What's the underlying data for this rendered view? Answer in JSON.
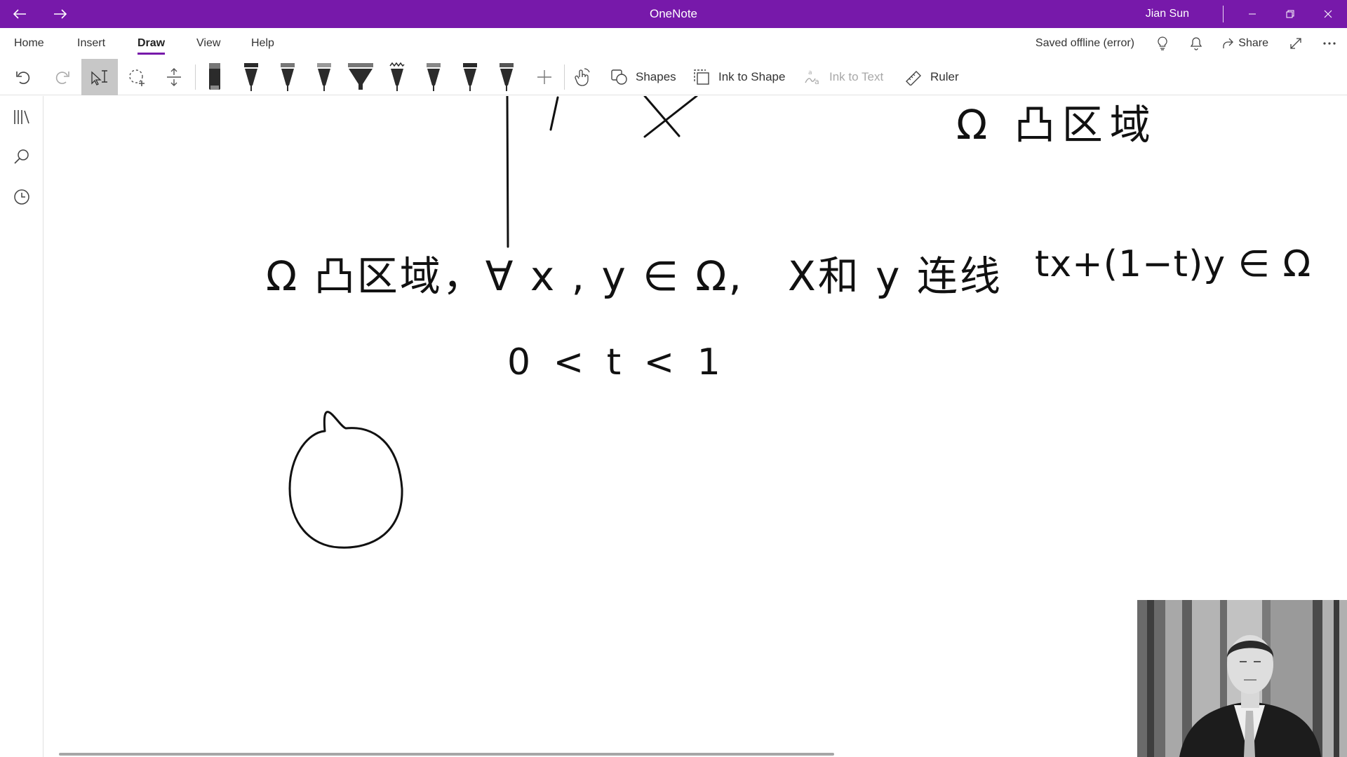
{
  "titlebar": {
    "app_title": "OneNote",
    "user_name": "Jian Sun",
    "back_icon": "arrow-left-icon",
    "forward_icon": "arrow-right-icon"
  },
  "menu": {
    "tabs": [
      {
        "label": "Home"
      },
      {
        "label": "Insert"
      },
      {
        "label": "Draw"
      },
      {
        "label": "View"
      },
      {
        "label": "Help"
      }
    ],
    "active_tab": "Draw",
    "status": "Saved offline (error)",
    "share_label": "Share"
  },
  "ribbon": {
    "shapes_label": "Shapes",
    "ink_to_shape_label": "Ink to Shape",
    "ink_to_text_label": "Ink to Text",
    "ruler_label": "Ruler"
  },
  "canvas": {
    "line1": "Ω 凸区域",
    "line2a": "Ω 凸区域，∀ x , y ∈ Ω,",
    "line2b": "X和 y 连线",
    "line2c": "tx+(1−t)y ∈ Ω",
    "line3": "0 < t < 1"
  },
  "colors": {
    "accent": "#7719aa"
  }
}
